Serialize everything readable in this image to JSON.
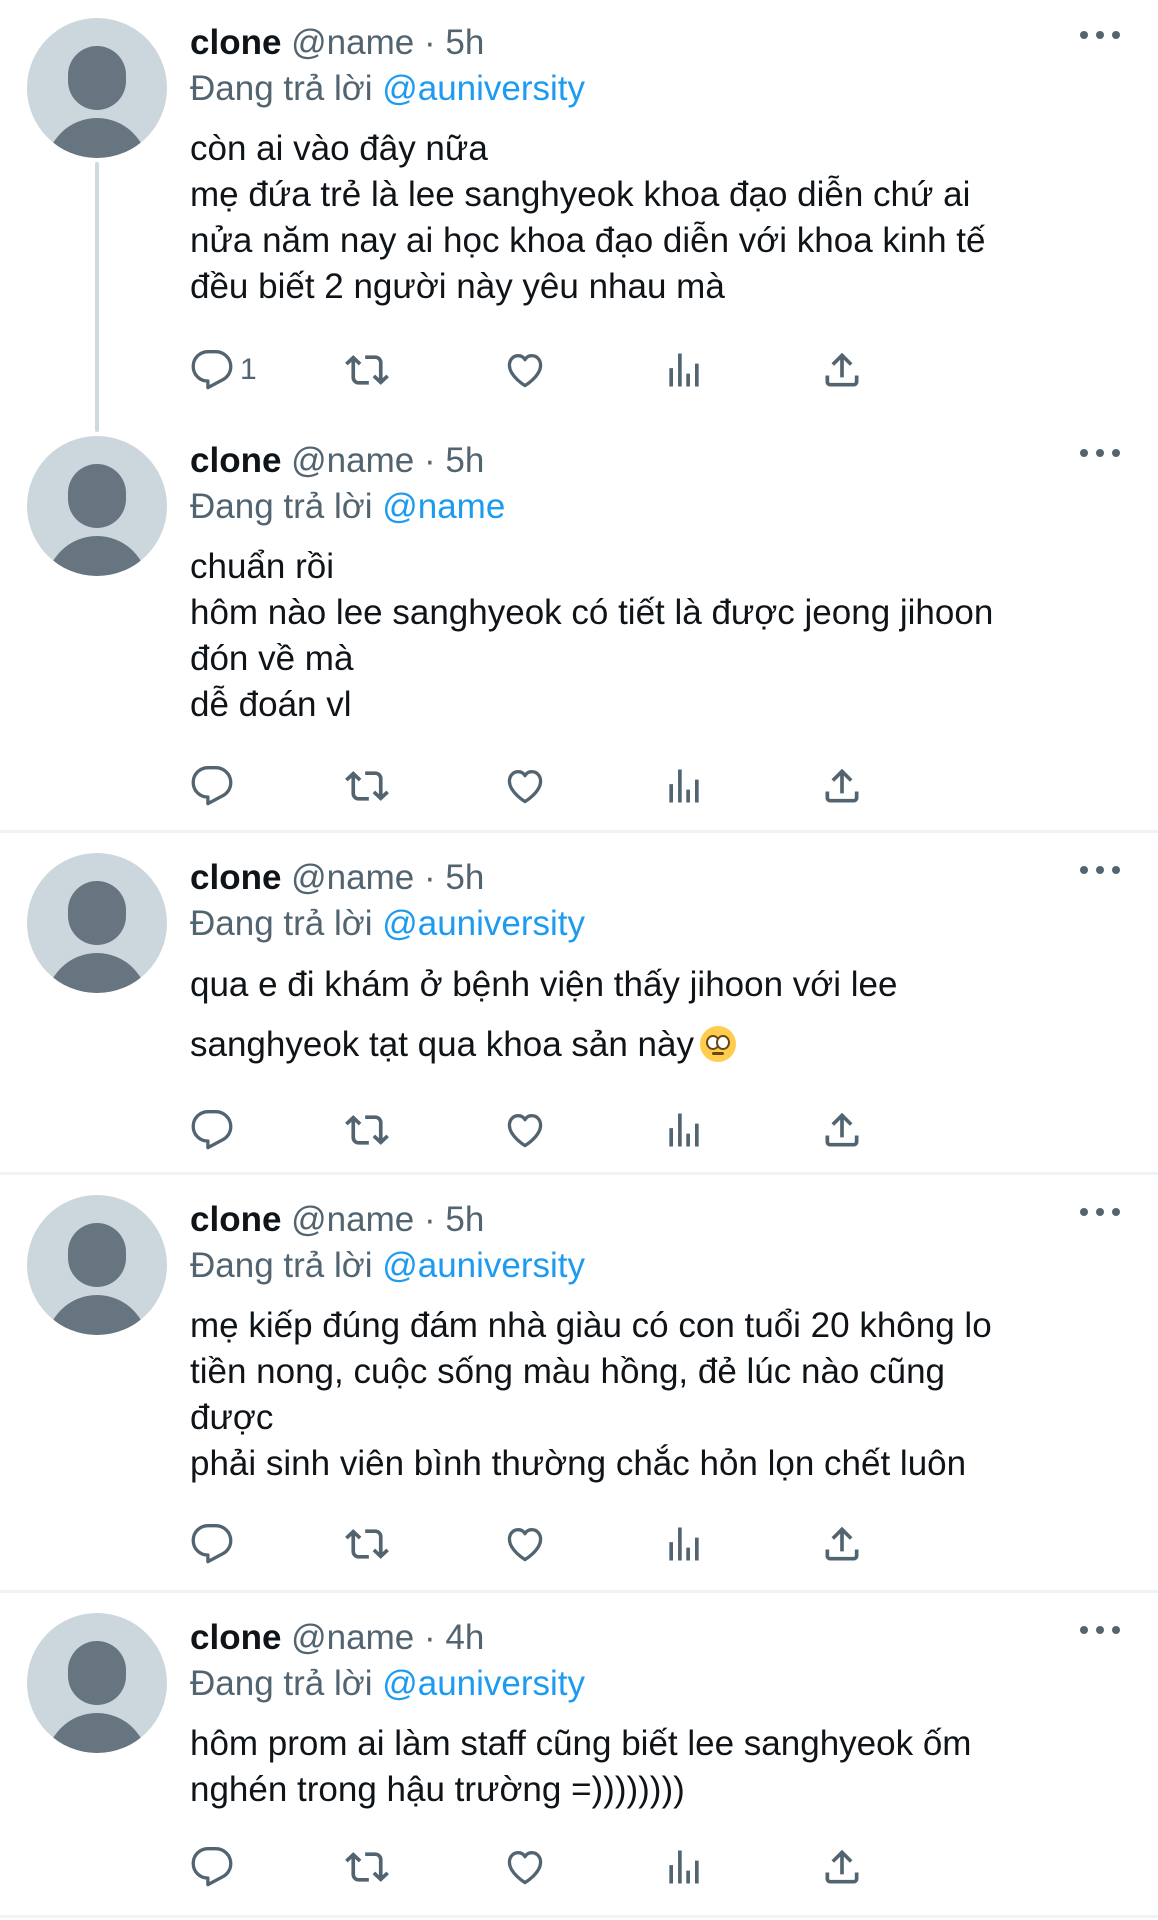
{
  "tweets": [
    {
      "display_name": "clone",
      "handle": "@name",
      "dot": "·",
      "time": "5h",
      "reply_prefix": "Đang trả lời",
      "reply_to": "@auniversity",
      "text": "còn ai vào đây nữa\nmẹ đứa trẻ là lee sanghyeok khoa đạo diễn chứ ai\nnửa năm nay ai học khoa đạo diễn với khoa kinh tế\nđều biết 2 người này yêu nhau mà",
      "reply_count": "1"
    },
    {
      "display_name": "clone",
      "handle": "@name",
      "dot": "·",
      "time": "5h",
      "reply_prefix": "Đang trả lời",
      "reply_to": "@name",
      "text": "chuẩn rồi\nhôm nào lee sanghyeok có tiết là được jeong jihoon\nđón về mà\ndễ đoán vl",
      "reply_count": ""
    },
    {
      "display_name": "clone",
      "handle": "@name",
      "dot": "·",
      "time": "5h",
      "reply_prefix": "Đang trả lời",
      "reply_to": "@auniversity",
      "text": "qua e đi khám ở bệnh viện thấy jihoon với lee\nsanghyeok tạt qua khoa sản này",
      "emoji": "face-with-rolling-eyes",
      "reply_count": ""
    },
    {
      "display_name": "clone",
      "handle": "@name",
      "dot": "·",
      "time": "5h",
      "reply_prefix": "Đang trả lời",
      "reply_to": "@auniversity",
      "text": "mẹ kiếp đúng đám nhà giàu có con tuổi 20 không lo\ntiền nong, cuộc sống màu hồng, đẻ lúc nào cũng\nđược\nphải sinh viên bình thường chắc hỏn lọn chết luôn",
      "reply_count": ""
    },
    {
      "display_name": "clone",
      "handle": "@name",
      "dot": "·",
      "time": "4h",
      "reply_prefix": "Đang trả lời",
      "reply_to": "@auniversity",
      "text": "hôm prom ai làm staff cũng biết lee sanghyeok ốm\nnghén trong hậu trường =))))))))",
      "reply_count": ""
    }
  ],
  "icons": {
    "reply": "reply-icon",
    "retweet": "retweet-icon",
    "like": "like-icon",
    "views": "views-icon",
    "share": "share-icon",
    "more": "more-icon"
  },
  "colors": {
    "link": "#1d9bf0",
    "secondary_text": "#536471",
    "avatar_bg": "#ccd6dd",
    "avatar_fg": "#66757f",
    "divider": "#eff3f4"
  }
}
